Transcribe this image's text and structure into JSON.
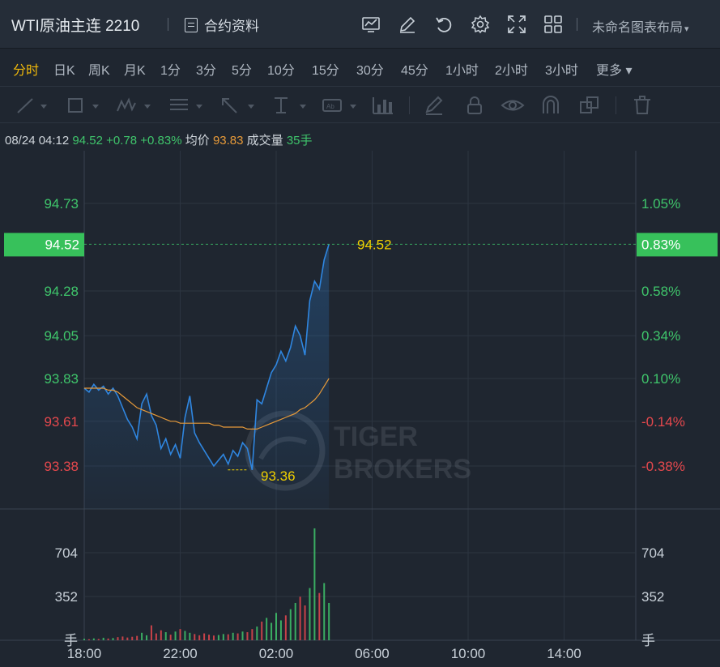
{
  "header": {
    "title": "WTI原油主连 2210",
    "contract_info": "合约资料",
    "layout_label": "未命名图表布局",
    "caret": "▾"
  },
  "timeframes": [
    {
      "label": "分时",
      "active": true
    },
    {
      "label": "日K"
    },
    {
      "label": "周K"
    },
    {
      "label": "月K"
    },
    {
      "label": "1分"
    },
    {
      "label": "3分"
    },
    {
      "label": "5分"
    },
    {
      "label": "10分"
    },
    {
      "label": "15分"
    },
    {
      "label": "30分"
    },
    {
      "label": "45分"
    },
    {
      "label": "1小时"
    },
    {
      "label": "2小时"
    },
    {
      "label": "3小时"
    },
    {
      "label": "更多 ▾"
    }
  ],
  "info": {
    "datetime": "08/24 04:12",
    "price": "94.52",
    "change": "+0.78",
    "change_pct": "+0.83%",
    "avg_label": "均价",
    "avg": "93.83",
    "volume_label": "成交量",
    "volume": "35手"
  },
  "watermark": {
    "line1": "TIGER",
    "line2": "BROKERS"
  },
  "colors": {
    "up": "#3fc56b",
    "down": "#e5484d",
    "price_line": "#2f86e0",
    "avg_line": "#e79a39",
    "highlight": "#f0d000",
    "badge": "#37c15b"
  },
  "chart_data": {
    "type": "line",
    "title": "",
    "price_axis_left": [
      "94.73",
      "94.52",
      "94.28",
      "94.05",
      "93.83",
      "93.61",
      "93.38"
    ],
    "price_axis_right": [
      "1.05%",
      "0.83%",
      "0.58%",
      "0.34%",
      "0.10%",
      "-0.14%",
      "-0.38%"
    ],
    "volume_axis": [
      "704",
      "352",
      "手"
    ],
    "x_ticks": [
      "18:00",
      "22:00",
      "02:00",
      "06:00",
      "10:00",
      "14:00"
    ],
    "ylim": [
      93.14,
      94.96
    ],
    "high": {
      "value": 94.52,
      "label": "94.52"
    },
    "low": {
      "value": 93.36,
      "label": "93.36"
    },
    "current_price_label": "94.52",
    "current_pct_label": "0.83%",
    "x_time_hours": [
      0,
      0.2,
      0.4,
      0.6,
      0.8,
      1.0,
      1.2,
      1.4,
      1.6,
      1.8,
      2.0,
      2.2,
      2.4,
      2.6,
      2.8,
      3.0,
      3.2,
      3.4,
      3.6,
      3.8,
      4.0,
      4.2,
      4.4,
      4.6,
      4.8,
      5.0,
      5.2,
      5.4,
      5.6,
      5.8,
      6.0,
      6.2,
      6.4,
      6.6,
      6.8,
      7.0,
      7.2,
      7.4,
      7.6,
      7.8,
      8.0,
      8.2,
      8.4,
      8.6,
      8.8,
      9.0,
      9.2,
      9.4,
      9.6,
      9.8,
      10.0,
      10.2
    ],
    "series": [
      {
        "name": "price",
        "values": [
          93.78,
          93.76,
          93.8,
          93.77,
          93.79,
          93.75,
          93.78,
          93.74,
          93.68,
          93.62,
          93.58,
          93.52,
          93.7,
          93.75,
          93.64,
          93.59,
          93.47,
          93.52,
          93.44,
          93.49,
          93.42,
          93.63,
          93.74,
          93.55,
          93.5,
          93.46,
          93.42,
          93.38,
          93.41,
          93.44,
          93.39,
          93.46,
          93.43,
          93.5,
          93.47,
          93.36,
          93.72,
          93.7,
          93.78,
          93.86,
          93.9,
          93.97,
          93.92,
          93.99,
          94.1,
          94.05,
          93.95,
          94.23,
          94.33,
          94.29,
          94.44,
          94.52
        ]
      },
      {
        "name": "avg",
        "values": [
          93.78,
          93.78,
          93.78,
          93.78,
          93.78,
          93.77,
          93.77,
          93.76,
          93.74,
          93.72,
          93.7,
          93.68,
          93.67,
          93.66,
          93.65,
          93.64,
          93.63,
          93.62,
          93.61,
          93.61,
          93.6,
          93.6,
          93.6,
          93.6,
          93.6,
          93.6,
          93.6,
          93.59,
          93.59,
          93.58,
          93.58,
          93.58,
          93.58,
          93.58,
          93.57,
          93.57,
          93.57,
          93.58,
          93.59,
          93.6,
          93.61,
          93.62,
          93.63,
          93.64,
          93.65,
          93.67,
          93.68,
          93.7,
          93.72,
          93.75,
          93.79,
          93.83
        ]
      },
      {
        "name": "volume",
        "values": [
          12,
          8,
          15,
          10,
          20,
          14,
          18,
          25,
          30,
          22,
          28,
          35,
          60,
          40,
          120,
          55,
          80,
          65,
          45,
          70,
          90,
          75,
          60,
          50,
          40,
          55,
          45,
          38,
          42,
          50,
          48,
          60,
          55,
          70,
          65,
          90,
          110,
          150,
          180,
          140,
          220,
          160,
          200,
          250,
          300,
          350,
          280,
          420,
          900,
          380,
          460,
          300
        ]
      }
    ]
  }
}
